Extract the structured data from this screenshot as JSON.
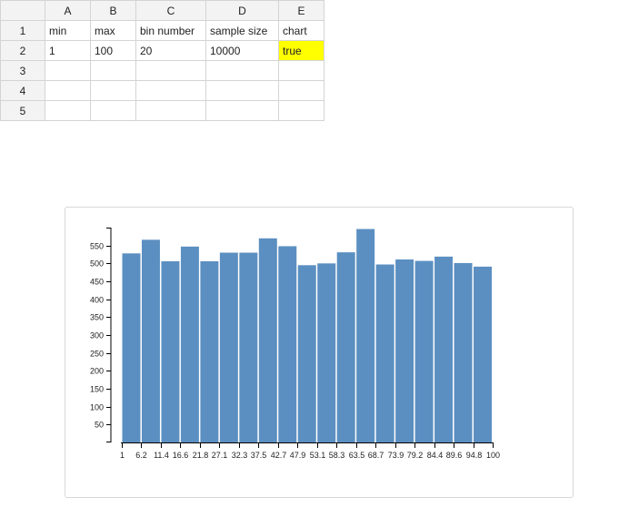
{
  "sheet": {
    "columns": [
      "A",
      "B",
      "C",
      "D",
      "E"
    ],
    "rows": [
      {
        "row": "1",
        "cells": [
          "min",
          "max",
          "bin number",
          "sample size",
          "chart"
        ]
      },
      {
        "row": "2",
        "cells": [
          "1",
          "100",
          "20",
          "10000",
          "true"
        ]
      },
      {
        "row": "3",
        "cells": [
          "",
          "",
          "",
          "",
          ""
        ]
      },
      {
        "row": "4",
        "cells": [
          "",
          "",
          "",
          "",
          ""
        ]
      },
      {
        "row": "5",
        "cells": [
          "",
          "",
          "",
          "",
          ""
        ]
      }
    ],
    "highlight_cell": "E2",
    "highlight_color": "#ffff00"
  },
  "chart_data": {
    "type": "bar",
    "bar_color": "#5b8fc1",
    "categories": [
      "1",
      "6.2",
      "11.4",
      "16.6",
      "21.8",
      "27.1",
      "32.3",
      "37.5",
      "42.7",
      "47.9",
      "53.1",
      "58.3",
      "63.5",
      "68.7",
      "73.9",
      "79.2",
      "84.4",
      "89.6",
      "94.8",
      "100"
    ],
    "values": [
      528,
      566,
      506,
      547,
      506,
      530,
      530,
      570,
      548,
      495,
      500,
      531,
      596,
      497,
      511,
      507,
      519,
      501,
      491
    ],
    "y_ticks": [
      50,
      100,
      150,
      200,
      250,
      300,
      350,
      400,
      450,
      500,
      550
    ],
    "ylim": [
      0,
      600
    ],
    "xlabel": "",
    "ylabel": "",
    "grid": false
  }
}
